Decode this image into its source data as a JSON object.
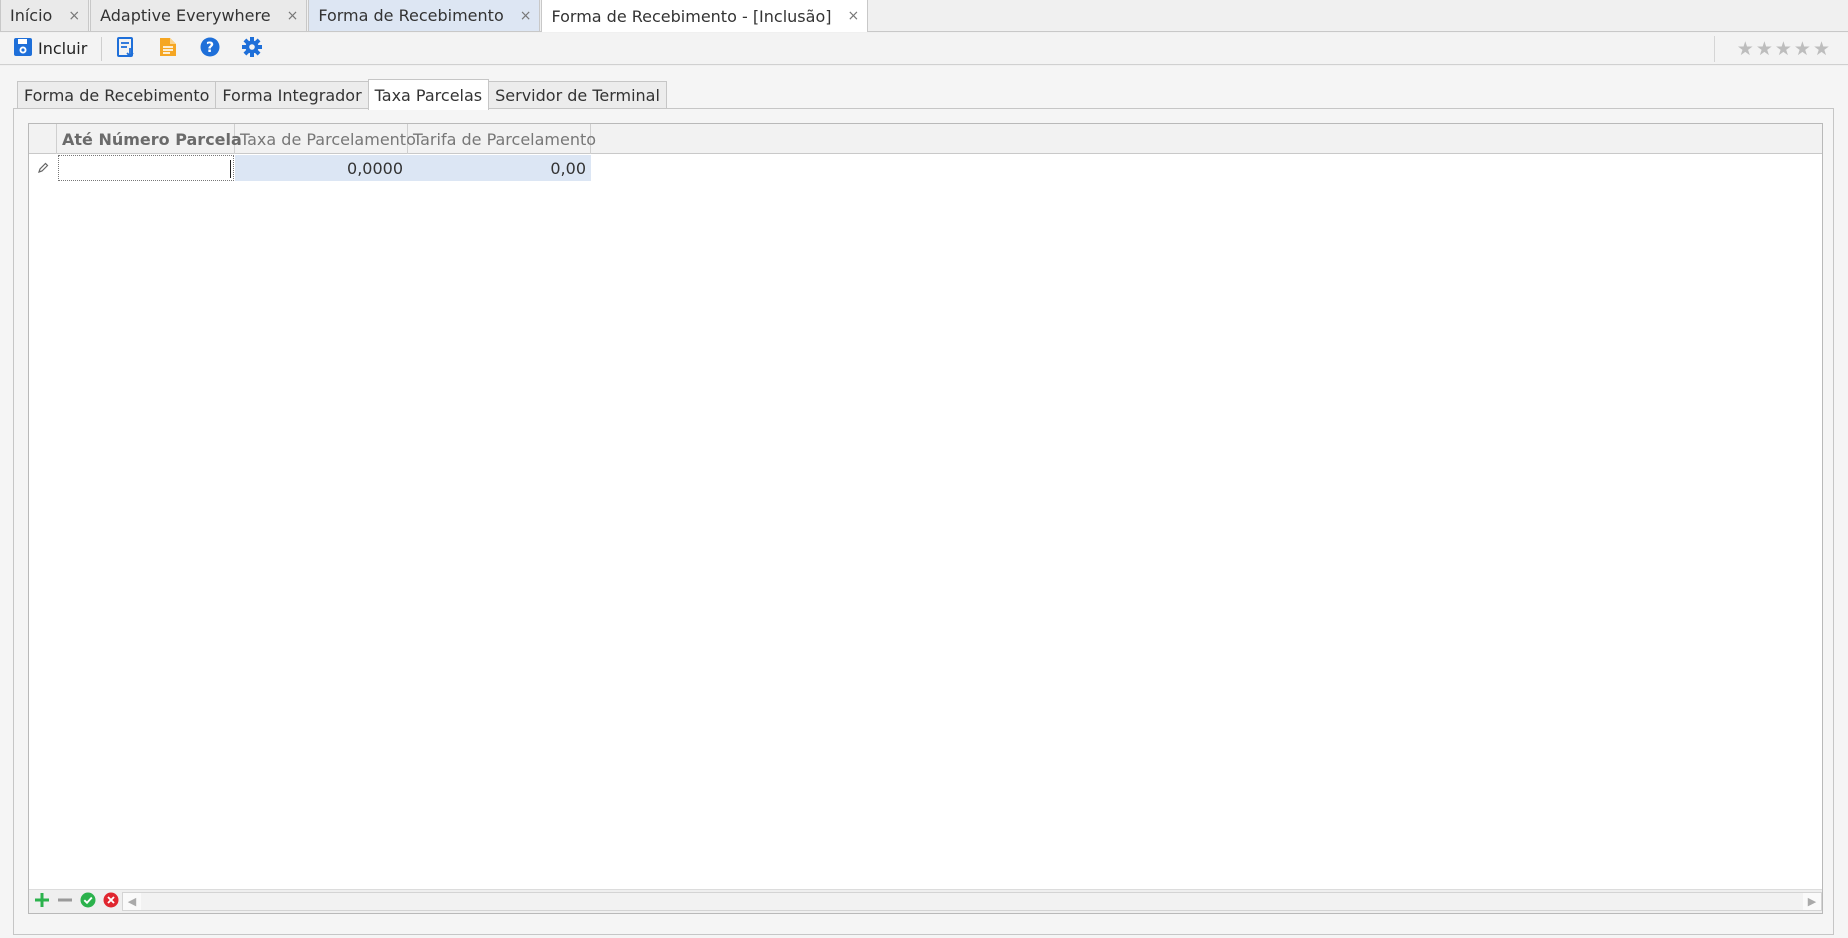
{
  "doc_tabs": [
    {
      "label": "Início",
      "close": "×"
    },
    {
      "label": "Adaptive Everywhere",
      "close": "×"
    },
    {
      "label": "Forma de Recebimento",
      "close": "×"
    },
    {
      "label": "Forma de Recebimento - [Inclusão]",
      "close": "×"
    }
  ],
  "toolbar": {
    "include_label": "Incluir",
    "icons": [
      "save-icon",
      "report-icon",
      "document-icon",
      "help-icon",
      "gear-icon"
    ],
    "stars": [
      "★",
      "★",
      "★",
      "★",
      "★"
    ]
  },
  "form_tabs": [
    "Forma de Recebimento",
    "Forma Integrador",
    "Taxa Parcelas",
    "Servidor de Terminal"
  ],
  "grid": {
    "columns": [
      "Até Número Parcela",
      "Taxa de Parcelamento",
      "Tarifa de Parcelamento"
    ],
    "rows": [
      {
        "ate_numero_parcela": "",
        "taxa_parcelamento": "0,0000",
        "tarifa_parcelamento": "0,00"
      }
    ]
  },
  "colors": {
    "accent_blue": "#1e6fd9",
    "selected_cell": "#dce6f4",
    "add_green": "#2bb24c",
    "cancel_red": "#e0262f"
  }
}
